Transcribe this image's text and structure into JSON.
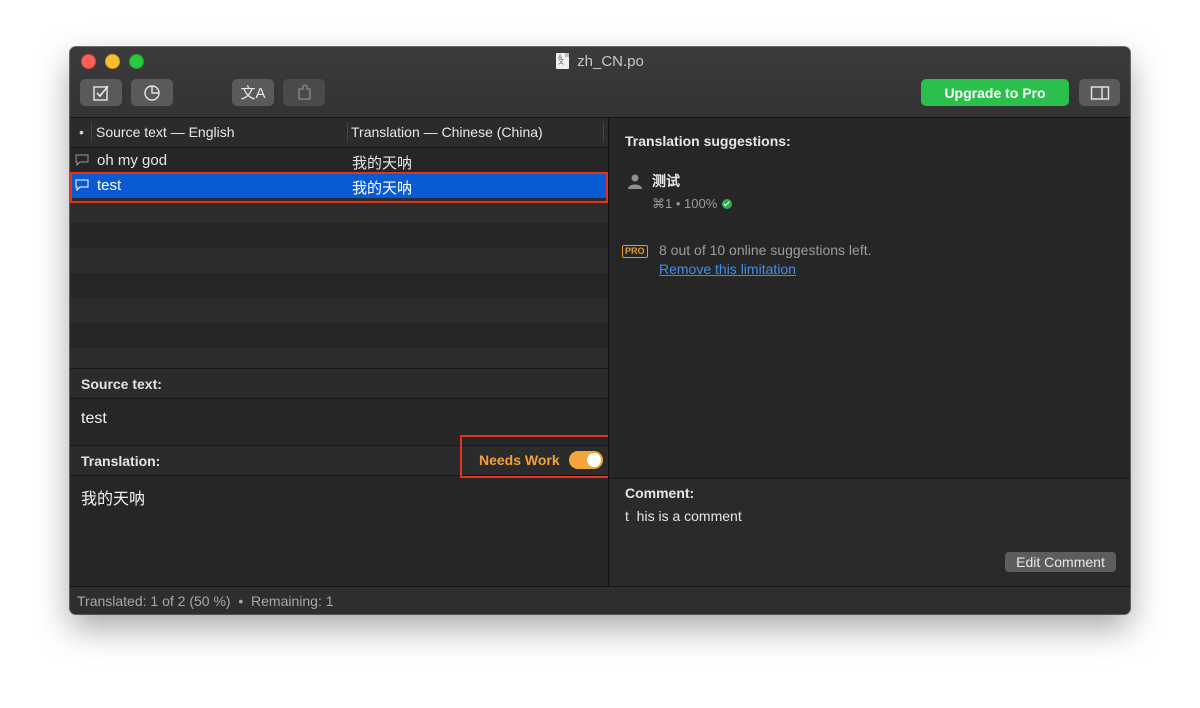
{
  "window": {
    "title": "zh_CN.po"
  },
  "toolbar": {
    "validate_icon": "checkbox-icon",
    "stats_icon": "pie-chart-icon",
    "translate_icon": "translate-icon",
    "translate_glyph": "文A",
    "paste_icon": "puzzle-icon",
    "upgrade_label": "Upgrade to Pro",
    "sidebar_icon": "sidebar-icon",
    "accent": "#2bc04d"
  },
  "table": {
    "headers": {
      "bullet": "•",
      "source": "Source text — English",
      "translation": "Translation — Chinese (China)"
    },
    "rows": [
      {
        "source": "oh my god",
        "translation": "我的天呐",
        "selected": false
      },
      {
        "source": "test",
        "translation": "我的天呐",
        "selected": true
      }
    ],
    "selection_color": "#0a5bd3"
  },
  "editor": {
    "source_label": "Source text:",
    "source_value": "test",
    "translation_label": "Translation:",
    "translation_value": "我的天呐",
    "needs_work_label": "Needs Work",
    "needs_work_on": true,
    "needs_work_color": "#f3a53a"
  },
  "suggestions": {
    "header": "Translation suggestions:",
    "items": [
      {
        "text": "测试",
        "meta": "⌘1 • 100%"
      }
    ],
    "pro_badge": "PRO",
    "limit_note": "8 out of 10 online suggestions left.",
    "limit_link": "Remove this limitation"
  },
  "comment": {
    "label": "Comment:",
    "text": "t  his is a comment",
    "edit_label": "Edit Comment"
  },
  "status": {
    "text": "Translated: 1 of 2 (50 %)  •  Remaining: 1"
  }
}
